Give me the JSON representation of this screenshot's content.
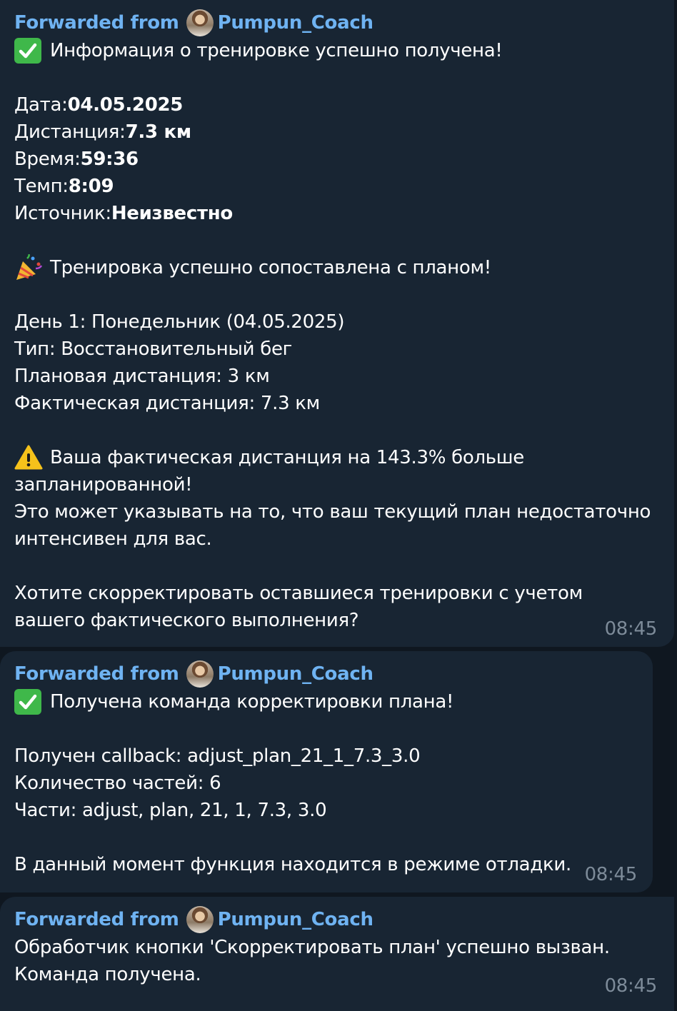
{
  "messages": [
    {
      "forwarded_label": "Forwarded from",
      "sender": "Pumpun_Coach",
      "lines": {
        "l1": "Информация о тренировке успешно получена!",
        "date_label": "Дата: ",
        "date_value": "04.05.2025",
        "distance_label": "Дистанция: ",
        "distance_value": "7.3 км",
        "time_label": "Время: ",
        "time_value": "59:36",
        "pace_label": "Темп: ",
        "pace_value": "8:09",
        "source_label": "Источник: ",
        "source_value": "Неизвестно",
        "matched": "Тренировка успешно сопоставлена с планом!",
        "day": "День 1: Понедельник (04.05.2025)",
        "type": "Тип: Восстановительный бег",
        "planned": "Плановая дистанция: 3 км",
        "actual": "Фактическая дистанция: 7.3 км",
        "warn1": "Ваша фактическая дистанция на 143.3% больше",
        "warn2": "запланированной!",
        "warn3": "Это может указывать на то, что ваш текущий план недостаточно",
        "warn4": "интенсивен для вас.",
        "q1": "Хотите скорректировать оставшиеся тренировки с учетом",
        "q2": "вашего фактического выполнения?"
      },
      "time": "08:45"
    },
    {
      "forwarded_label": "Forwarded from",
      "sender": "Pumpun_Coach",
      "lines": {
        "l1": "Получена команда корректировки плана!",
        "callback": "Получен callback: adjust_plan_21_1_7.3_3.0",
        "count": "Количество частей: 6",
        "parts": "Части: adjust, plan, 21, 1, 7.3, 3.0",
        "debug": "В данный момент функция находится в режиме отладки."
      },
      "time": "08:45"
    },
    {
      "forwarded_label": "Forwarded from",
      "sender": "Pumpun_Coach",
      "lines": {
        "l1": "Обработчик кнопки 'Скорректировать план' успешно вызван.",
        "l2": "Команда получена."
      },
      "time": "08:45"
    }
  ],
  "colors": {
    "background": "#0f1720",
    "bubble": "#182533",
    "forwarded": "#6fb3f2",
    "time": "#7d8b99",
    "check_emoji": "#3fb84a"
  },
  "icons": {
    "check": "check-mark-button-icon",
    "party": "party-popper-icon",
    "warning": "warning-sign-icon"
  }
}
